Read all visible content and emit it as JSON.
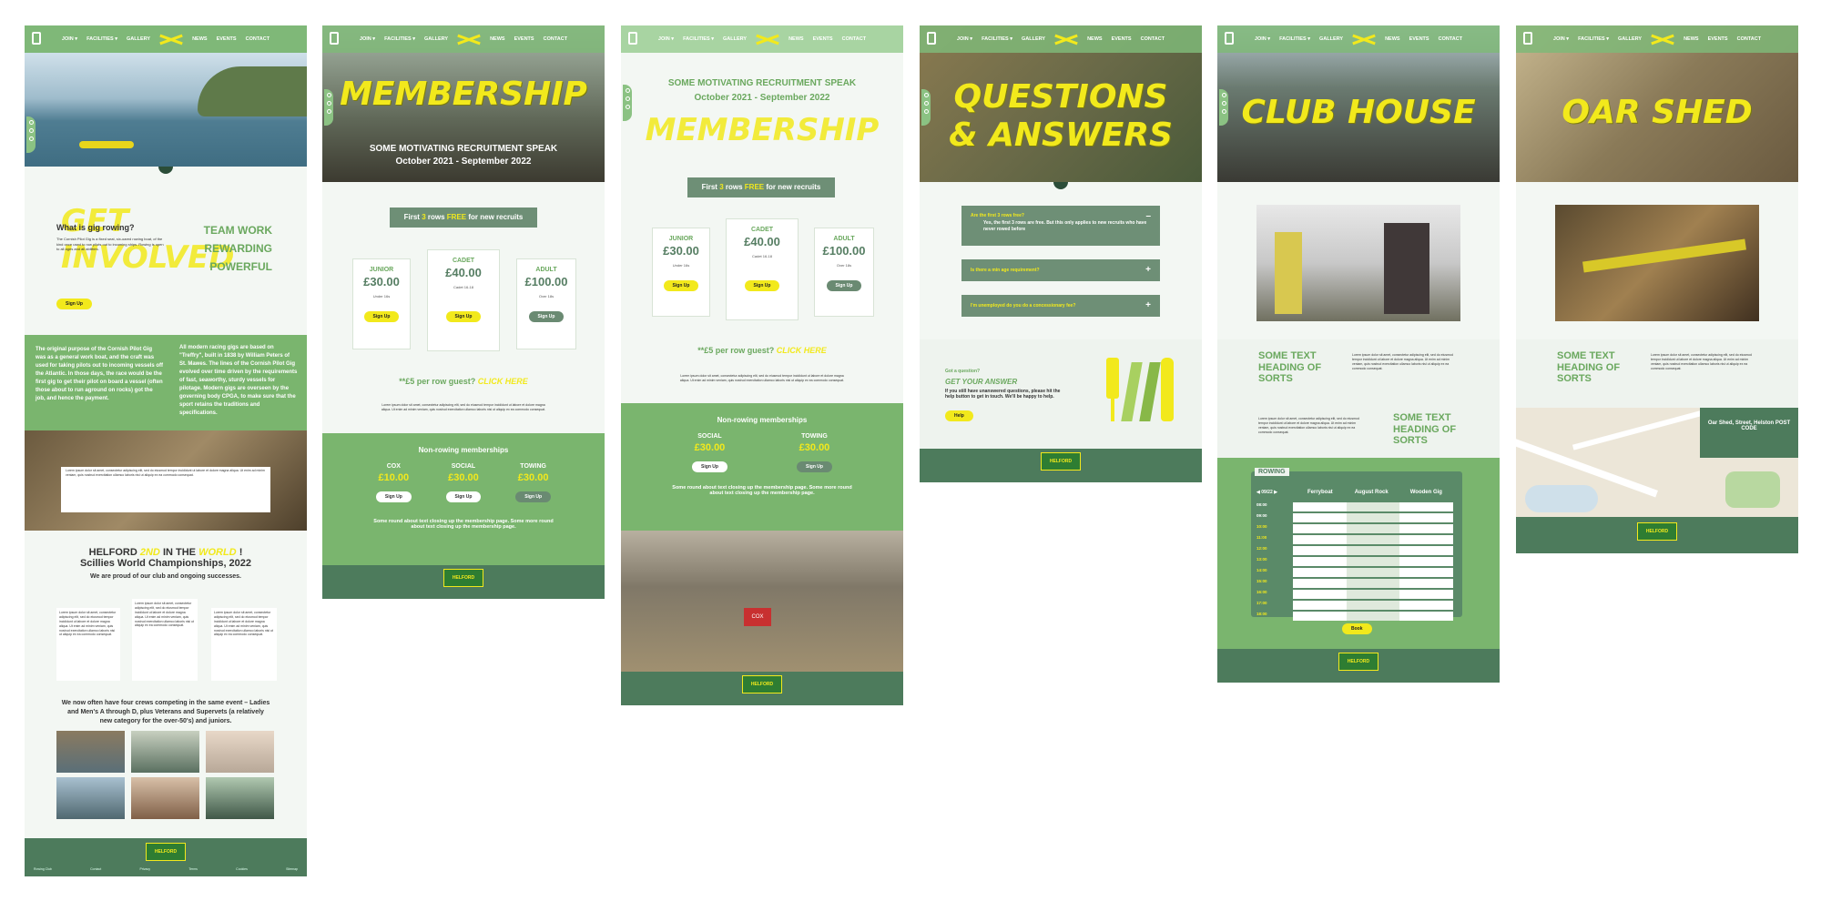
{
  "nav": {
    "items": [
      "JOIN ▾",
      "FACILITIES ▾",
      "GALLERY",
      "NEWS",
      "EVENTS",
      "CONTACT"
    ]
  },
  "p1": {
    "title": "GET INVOLVED",
    "q": "What is gig rowing?",
    "tags": [
      "TEAM WORK",
      "REWARDING",
      "POWERFUL"
    ],
    "para": "The Cornish Pilot Gig is a fixed seat, six-oared rowing boat, of the kind once used to row pilots out to incoming ships. Rowing is open to all ages and all abilities.",
    "signup": "Sign Up",
    "history_left": "The original purpose of the Cornish Pilot Gig was as a general work boat, and the craft was used for taking pilots out to incoming vessels off the Atlantic. In those days, the race would be the first gig to get their pilot on board a vessel (often those about to run aground on rocks) got the job, and hence the payment.",
    "history_right": "All modern racing gigs are based on \"Treffry\", built in 1838 by William Peters of St. Mawes. The lines of the Cornish Pilot Gig evolved over time driven by the requirements of fast, seaworthy, sturdy vessels for pilotage. Modern gigs are overseen by the governing body CPGA, to make sure that the sport retains the traditions and specifications.",
    "champs_l1a": "HELFORD",
    "champs_l1b": "2ND",
    "champs_l1c": "IN THE",
    "champs_l1d": "WORLD",
    "champs_l1e": "!",
    "champs_l2": "Scillies World Championships, 2022",
    "champs_sub": "We are proud of our club and ongoing successes.",
    "crews": "We now often have four crews competing in the same event – Ladies and Men's A through D, plus Veterans and Supervets (a relatively new category for the over-50's) and juniors."
  },
  "p2": {
    "title": "MEMBERSHIP",
    "hero_sub1": "SOME MOTIVATING RECRUITMENT SPEAK",
    "hero_sub2": "October 2021 - September 2022",
    "promo_a": "First",
    "promo_b": "3",
    "promo_c": "rows",
    "promo_d": "FREE",
    "promo_e": "for new recruits",
    "cards": [
      {
        "label": "JUNIOR",
        "amount": "£30.00",
        "note": "Under 16s",
        "btn": "Sign Up"
      },
      {
        "label": "CADET",
        "amount": "£40.00",
        "note": "Cadet 16-18",
        "btn": "Sign Up"
      },
      {
        "label": "ADULT",
        "amount": "£100.00",
        "note": "Over 18s",
        "btn": "Sign Up"
      }
    ],
    "guest": "**£5 per row guest?",
    "guest_link": "CLICK HERE",
    "nonrow_title": "Non-rowing memberships",
    "nonrow": [
      {
        "label": "COX",
        "amount": "£10.00",
        "btn": "Sign Up"
      },
      {
        "label": "SOCIAL",
        "amount": "£30.00",
        "btn": "Sign Up"
      },
      {
        "label": "TOWING",
        "amount": "£30.00",
        "btn": "Sign Up"
      }
    ],
    "closing": "Some round about text closing up the membership page. Some more round about text closing up the membership page."
  },
  "p3": {
    "top1": "SOME MOTIVATING RECRUITMENT SPEAK",
    "top2": "October 2021 - September 2022",
    "title": "MEMBERSHIP",
    "nonrow": [
      {
        "label": "SOCIAL",
        "amount": "£30.00",
        "btn": "Sign Up"
      },
      {
        "label": "TOWING",
        "amount": "£30.00",
        "btn": "Sign Up"
      }
    ],
    "coach": "COX"
  },
  "p4": {
    "title1": "QUESTIONS",
    "title2": "& ANSWERS",
    "faqs": [
      {
        "q": "Are the first 3 rows free?",
        "a": "Yes, the first 3 rows are free. But this only applies to new recruits who have never rowed before",
        "sign": "–"
      },
      {
        "q": "Is there a min age requirement?",
        "sign": "+"
      },
      {
        "q": "I'm unemployed do you do a concessionary fee?",
        "sign": "+"
      }
    ],
    "got_q": "Got a question?",
    "get_answer": "GET YOUR ANSWER",
    "help_text": "If you still have unanswered questions, please hit the help button to get in touch. We'll be happy to help.",
    "help_btn": "Help"
  },
  "p5": {
    "title": "CLUB HOUSE",
    "heading1": "SOME TEXT HEADING OF SORTS",
    "heading2": "SOME TEXT HEADING OF SORTS",
    "rowing": "ROWING",
    "cols": [
      "Ferryboat",
      "August Rock",
      "Wooden Gig"
    ],
    "times": [
      "08:00",
      "09:00",
      "10:00",
      "11:00",
      "12:00",
      "13:00",
      "14:00",
      "15:00",
      "16:00",
      "17:00",
      "18:00"
    ],
    "book": "Book"
  },
  "p6": {
    "title": "OAR SHED",
    "heading": "SOME TEXT HEADING OF SORTS",
    "addr": "Oar Shed, Street, Helston POST CODE"
  },
  "footer": {
    "badge": "HELFORD",
    "links": [
      "Rowing Club",
      "Contact",
      "Privacy",
      "Terms",
      "Cookies",
      "Sitemap"
    ]
  },
  "lorem": "Lorem ipsum dolor sit amet, consectetur adipiscing elit, sed do eiusmod tempor incididunt ut labore et dolore magna aliqua. Ut enim ad minim veniam, quis nostrud exercitation ullamco laboris nisi ut aliquip ex ea commodo consequat."
}
